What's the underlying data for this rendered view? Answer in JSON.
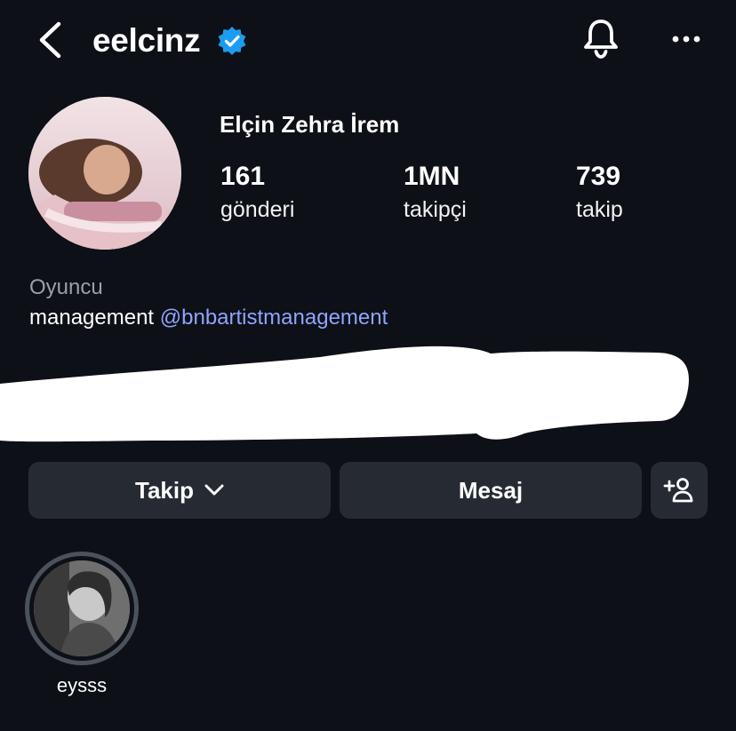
{
  "header": {
    "username": "eelcinz",
    "back_icon": "chevron-left-icon",
    "verified_icon": "verified-badge-icon",
    "notification_icon": "bell-icon",
    "more_icon": "more-horizontal-icon",
    "verified_color": "#1d9bf0"
  },
  "profile": {
    "full_name": "Elçin Zehra İrem",
    "stats": {
      "posts": {
        "value": "161",
        "label": "gönderi"
      },
      "followers": {
        "value": "1MN",
        "label": "takipçi"
      },
      "following": {
        "value": "739",
        "label": "takip"
      }
    },
    "category": "Oyuncu",
    "bio_prefix": "management ",
    "bio_mention": "@bnbartistmanagement",
    "mention_color": "#8ea4ff"
  },
  "actions": {
    "follow_label": "Takip",
    "follow_icon": "chevron-down-icon",
    "message_label": "Mesaj",
    "suggest_icon": "add-person-icon"
  },
  "highlights": [
    {
      "label": "eysss"
    }
  ]
}
